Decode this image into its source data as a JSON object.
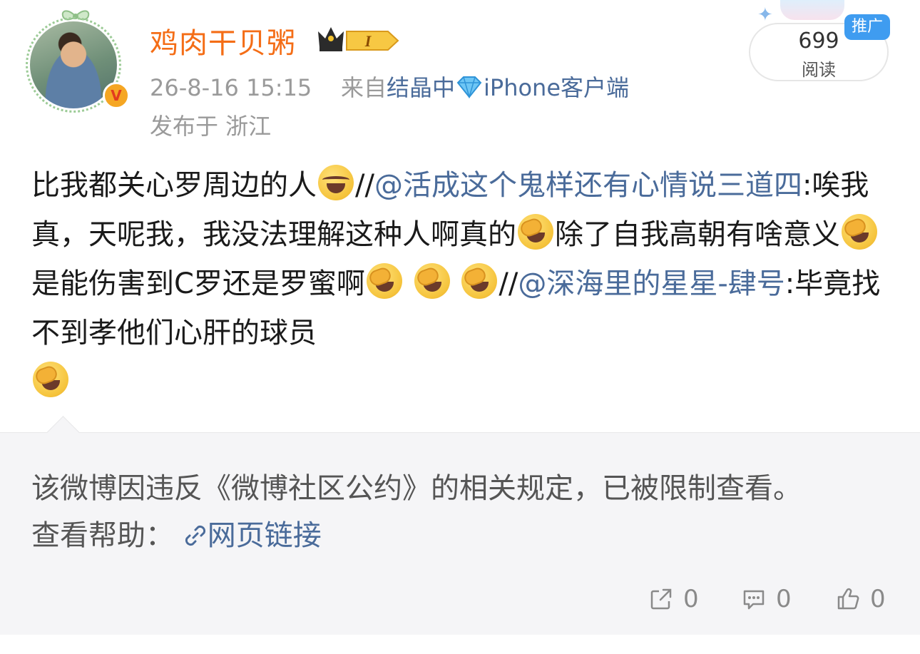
{
  "author": {
    "name": "鸡肉干贝粥",
    "level_badge": "I",
    "verified_mark": "V"
  },
  "meta": {
    "time": "26-8-16 15:15",
    "source_prefix": "来自",
    "source_a": "结晶中",
    "source_b": "iPhone客户端",
    "location": "发布于 浙江"
  },
  "reads": {
    "count": "699",
    "label": "阅读",
    "promo": "推广"
  },
  "post": {
    "t1": "比我都关心罗周边的人",
    "t2": "//",
    "m1": "@活成这个鬼样还有心情说三道四",
    "t3": ":唉我真，天呢我，我没法理解这种人啊真的",
    "t4": "除了自我高朝有啥意义",
    "t5": "是能伤害到C罗还是罗蜜啊",
    "t6": "//",
    "m2": "@深海里的星星-肆号",
    "t7": ":毕竟找不到孝他们心肝的球员"
  },
  "restriction": {
    "notice": "该微博因违反《微博社区公约》的相关规定，已被限制查看。",
    "help_label": "查看帮助：",
    "help_link": "网页链接"
  },
  "actions": {
    "repost_count": "0",
    "comment_count": "0",
    "like_count": "0"
  }
}
